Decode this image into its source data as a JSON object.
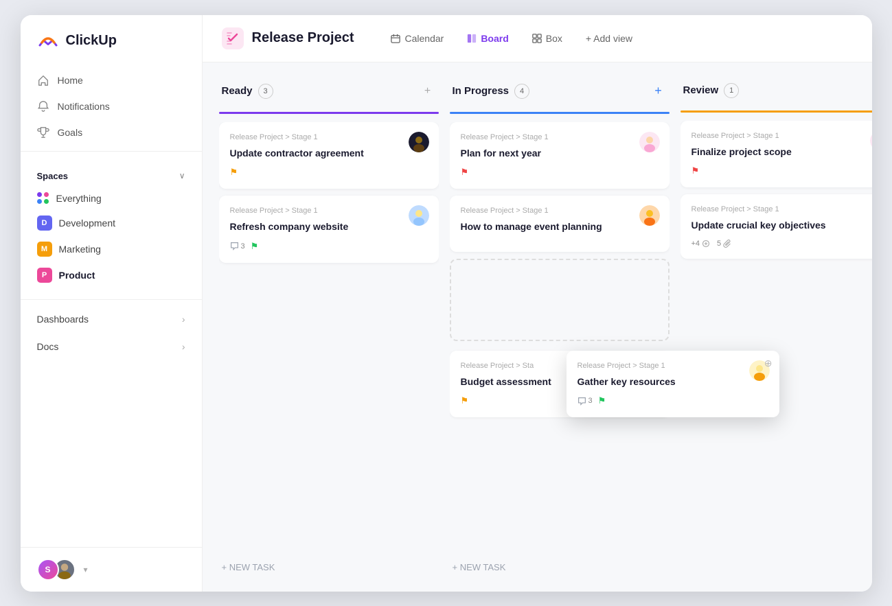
{
  "app": {
    "name": "ClickUp"
  },
  "sidebar": {
    "nav": [
      {
        "id": "home",
        "label": "Home",
        "icon": "home"
      },
      {
        "id": "notifications",
        "label": "Notifications",
        "icon": "bell"
      },
      {
        "id": "goals",
        "label": "Goals",
        "icon": "trophy"
      }
    ],
    "spaces_title": "Spaces",
    "spaces": [
      {
        "id": "everything",
        "label": "Everything",
        "type": "grid"
      },
      {
        "id": "development",
        "label": "Development",
        "color": "#6366f1",
        "letter": "D"
      },
      {
        "id": "marketing",
        "label": "Marketing",
        "color": "#f59e0b",
        "letter": "M"
      },
      {
        "id": "product",
        "label": "Product",
        "color": "#ec4899",
        "letter": "P",
        "active": true
      }
    ],
    "links": [
      {
        "id": "dashboards",
        "label": "Dashboards"
      },
      {
        "id": "docs",
        "label": "Docs"
      }
    ]
  },
  "header": {
    "project_title": "Release Project",
    "views": [
      {
        "id": "calendar",
        "label": "Calendar",
        "active": false
      },
      {
        "id": "board",
        "label": "Board",
        "active": true
      },
      {
        "id": "box",
        "label": "Box",
        "active": false
      }
    ],
    "add_view_label": "+ Add view"
  },
  "board": {
    "columns": [
      {
        "id": "ready",
        "title": "Ready",
        "count": 3,
        "bar_color": "#7c3aed",
        "cards": [
          {
            "id": "card-1",
            "meta": "Release Project > Stage 1",
            "title": "Update contractor agreement",
            "flag": "orange",
            "avatar_color": "#f97316",
            "has_avatar": true
          },
          {
            "id": "card-2",
            "meta": "Release Project > Stage 1",
            "title": "Refresh company website",
            "flag": "green",
            "comment_count": 3,
            "has_avatar": true,
            "avatar_color": "#38bdf8"
          }
        ],
        "new_task_label": "+ NEW TASK"
      },
      {
        "id": "inprogress",
        "title": "In Progress",
        "count": 4,
        "bar_color": "#3b82f6",
        "cards": [
          {
            "id": "card-3",
            "meta": "Release Project > Stage 1",
            "title": "Plan for next year",
            "flag": "red",
            "has_avatar": true,
            "avatar_color": "#f87171"
          },
          {
            "id": "card-4",
            "meta": "Release Project > Stage 1",
            "title": "How to manage event planning",
            "flag": "",
            "has_avatar": true,
            "avatar_color": "#fb923c"
          },
          {
            "id": "card-5-dashed",
            "meta": "",
            "title": "",
            "dashed": true
          },
          {
            "id": "card-6",
            "meta": "Release Project > Sta",
            "title": "Budget assessment",
            "flag": "orange"
          }
        ],
        "new_task_label": "+ NEW TASK"
      },
      {
        "id": "review",
        "title": "Review",
        "count": 1,
        "bar_color": "#f59e0b",
        "cards": [
          {
            "id": "card-7",
            "meta": "Release Project > Stage 1",
            "title": "Finalize project scope",
            "flag": "red",
            "has_avatar": true,
            "avatar_color": "#f87171"
          },
          {
            "id": "card-8",
            "meta": "Release Project > Stage 1",
            "title": "Update crucial key objectives",
            "flag": "",
            "plus_count": "+4",
            "attachment_count": "5",
            "comment_note": true
          }
        ]
      }
    ]
  },
  "floating_card": {
    "meta": "Release Project > Stage 1",
    "title": "Gather key resources",
    "comment_count": 3,
    "flag": "green"
  }
}
